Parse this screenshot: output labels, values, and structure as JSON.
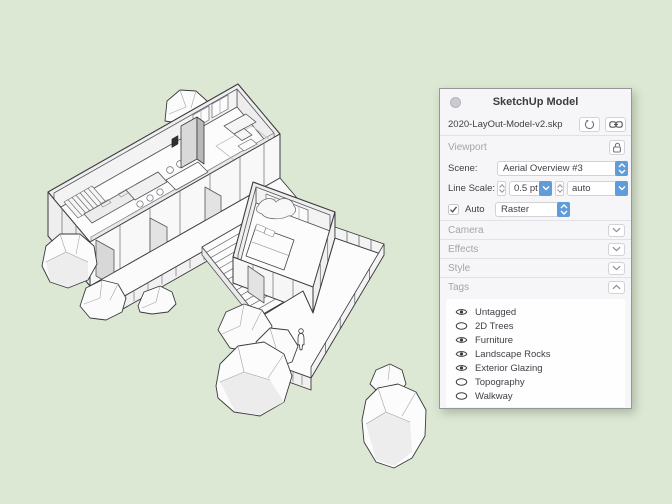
{
  "canvas": {
    "background": "#dde8d4"
  },
  "panel": {
    "title": "SketchUp Model",
    "file_name": "2020-LayOut-Model-v2.skp",
    "header_buttons": {
      "render": "render-circle-icon",
      "link": "link-icon"
    },
    "viewport": {
      "label": "Viewport",
      "lock": "unlock-icon"
    },
    "scene": {
      "label": "Scene:",
      "value": "Aerial Overview #3"
    },
    "line_scale": {
      "label": "Line Scale:",
      "value": "0.5 pt",
      "dash_value": "auto"
    },
    "auto": {
      "label": "Auto",
      "checked": true,
      "render_mode": "Raster"
    },
    "sections": [
      {
        "label": "Camera",
        "expanded": false
      },
      {
        "label": "Effects",
        "expanded": false
      },
      {
        "label": "Style",
        "expanded": false
      },
      {
        "label": "Tags",
        "expanded": true
      }
    ],
    "tags": {
      "items": [
        {
          "label": "Untagged",
          "visible": true
        },
        {
          "label": "2D Trees",
          "visible": false
        },
        {
          "label": "Furniture",
          "visible": true
        },
        {
          "label": "Landscape Rocks",
          "visible": true
        },
        {
          "label": "Exterior Glazing",
          "visible": true
        },
        {
          "label": "Topography",
          "visible": false
        },
        {
          "label": "Walkway",
          "visible": false
        }
      ]
    },
    "colors": {
      "accent_blue": "#5f9cd8",
      "panel_bg": "#f6f5f7"
    }
  }
}
